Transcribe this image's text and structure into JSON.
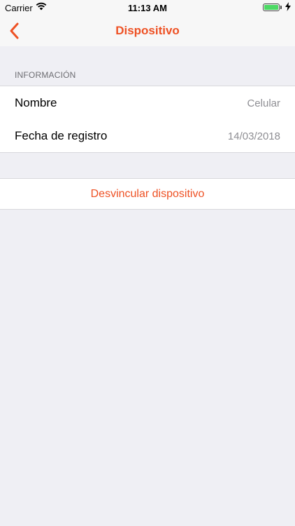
{
  "status_bar": {
    "carrier": "Carrier",
    "time": "11:13 AM",
    "icons": [
      "wifi-icon",
      "battery-icon",
      "charging-bolt-icon"
    ]
  },
  "nav": {
    "title": "Dispositivo",
    "back_icon": "chevron-left-icon",
    "accent_color": "#ee5124"
  },
  "section": {
    "header": "INFORMACIÓN",
    "rows": [
      {
        "label": "Nombre",
        "value": "Celular"
      },
      {
        "label": "Fecha de registro",
        "value": "14/03/2018"
      }
    ]
  },
  "action": {
    "label": "Desvincular dispositivo"
  }
}
